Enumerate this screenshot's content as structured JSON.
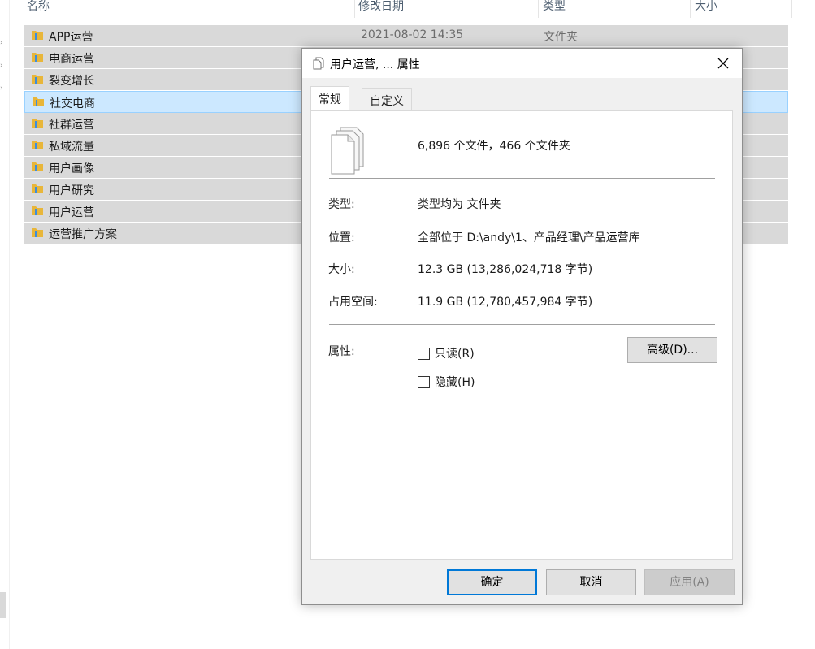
{
  "explorer": {
    "columns": {
      "name": "名称",
      "date": "修改日期",
      "type": "类型",
      "size": "大小"
    },
    "rows": [
      {
        "name": "APP运营",
        "date": "2021-08-02 14:35",
        "type": "文件夹"
      },
      {
        "name": "电商运营"
      },
      {
        "name": "裂变增长"
      },
      {
        "name": "社交电商"
      },
      {
        "name": "社群运营"
      },
      {
        "name": "私域流量"
      },
      {
        "name": "用户画像"
      },
      {
        "name": "用户研究"
      },
      {
        "name": "用户运营"
      },
      {
        "name": "运营推广方案"
      }
    ],
    "selected_index": 3,
    "folder_color": "#e8b63a"
  },
  "dialog": {
    "title": "用户运营, ... 属性",
    "tabs": [
      {
        "label": "常规"
      },
      {
        "label": "自定义"
      }
    ],
    "summary": "6,896 个文件，466 个文件夹",
    "fields": [
      {
        "label": "类型:",
        "value": "类型均为 文件夹"
      },
      {
        "label": "位置:",
        "value": "全部位于 D:\\andy\\1、产品经理\\产品运营库"
      },
      {
        "label": "大小:",
        "value": "12.3 GB (13,286,024,718 字节)"
      },
      {
        "label": "占用空间:",
        "value": "11.9 GB (12,780,457,984 字节)"
      }
    ],
    "attributes_label": "属性:",
    "readonly_label": "只读(R)",
    "hidden_label": "隐藏(H)",
    "advanced_label": "高级(D)...",
    "ok_label": "确定",
    "cancel_label": "取消",
    "apply_label": "应用(A)",
    "accent_color": "#0078d7"
  }
}
